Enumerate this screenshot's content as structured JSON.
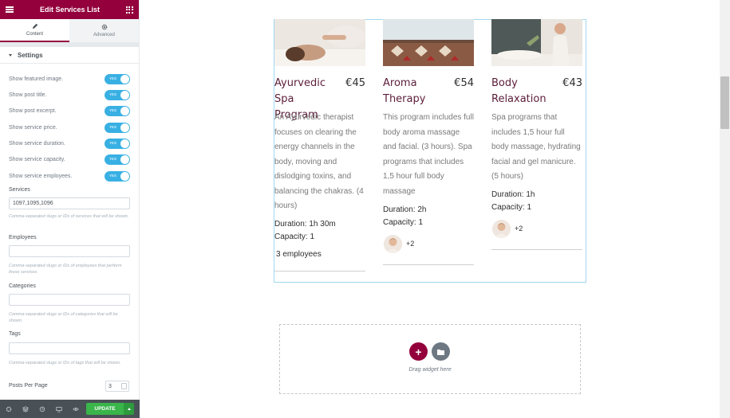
{
  "header": {
    "title": "Edit Services List"
  },
  "tabs": [
    {
      "label": "Content",
      "icon": "pencil-icon"
    },
    {
      "label": "Advanced",
      "icon": "gear-icon"
    }
  ],
  "section": {
    "title": "Settings"
  },
  "switches": [
    {
      "label": "Show featured image.",
      "state": "YES"
    },
    {
      "label": "Show post title.",
      "state": "YES"
    },
    {
      "label": "Show post excerpt.",
      "state": "YES"
    },
    {
      "label": "Show service price.",
      "state": "YES"
    },
    {
      "label": "Show service duration.",
      "state": "YES"
    },
    {
      "label": "Show service capacity.",
      "state": "YES"
    },
    {
      "label": "Show service employees.",
      "state": "YES"
    }
  ],
  "fields": {
    "services": {
      "label": "Services",
      "value": "1097,1095,1096",
      "help": "Comma-separated slugs or IDs of services that will be shown."
    },
    "employees": {
      "label": "Employees",
      "value": "",
      "help": "Comma-separated slugs or IDs of employees that perform these services."
    },
    "categories": {
      "label": "Categories",
      "value": "",
      "help": "Comma-separated slugs or IDs of categories that will be shown."
    },
    "tags": {
      "label": "Tags",
      "value": "",
      "help": "Comma-separated slugs or IDs of tags that will be shown."
    },
    "posts_per_page": {
      "label": "Posts Per Page",
      "value": "3"
    }
  },
  "footer": {
    "update_label": "UPDATE"
  },
  "cards": [
    {
      "title": "Ayurvedic Spa Program",
      "price": "€45",
      "description": "An Ayurvedic therapist focuses on clearing the energy channels in the body, moving and dislodging toxins, and balancing the chakras. (4 hours)",
      "duration": "Duration: 1h 30m",
      "capacity": "Capacity: 1",
      "employees": "3 employees"
    },
    {
      "title": "Aroma Therapy",
      "price": "€54",
      "description": "This program includes full body aroma massage and facial. (3 hours). Spa programs that includes 1,5 hour full body massage",
      "duration": "Duration: 2h",
      "capacity": "Capacity: 1",
      "more": "+2"
    },
    {
      "title": "Body Relaxation",
      "price": "€43",
      "description": "Spa programs that includes 1,5 hour full body massage, hydrating facial and gel manicure. (5 hours)",
      "duration": "Duration: 1h",
      "capacity": "Capacity: 1",
      "more": "+2"
    }
  ],
  "dropzone": {
    "text": "Drag widget here"
  },
  "colors": {
    "brand": "#93003c",
    "toggle": "#39b0e3",
    "update": "#39b54a"
  }
}
